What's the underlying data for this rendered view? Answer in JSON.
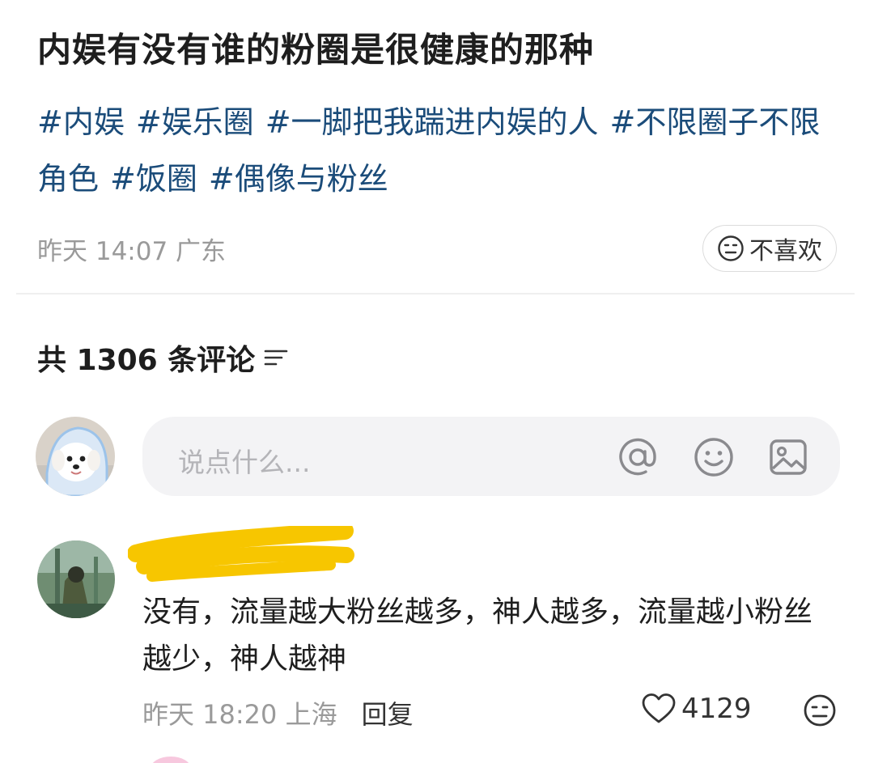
{
  "post": {
    "title": "内娱有没有谁的粉圈是很健康的那种",
    "tags": [
      "#内娱",
      "#娱乐圈",
      "#一脚把我踹进内娱的人",
      "#不限圈子不限角色",
      "#饭圈",
      "#偶像与粉丝"
    ],
    "meta": "昨天 14:07 广东",
    "dislike_label": "不喜欢"
  },
  "comments_header": {
    "label": "共 1306 条评论",
    "sort_icon": "sort-icon"
  },
  "composer": {
    "placeholder": "说点什么...",
    "icons": [
      "at-icon",
      "emoji-icon",
      "image-icon"
    ]
  },
  "comment": {
    "text": "没有，流量越大粉丝越多，神人越多，流量越小粉丝越少，神人越神",
    "time": "昨天 18:20 上海",
    "reply_label": "回复",
    "likes": "4129"
  },
  "colors": {
    "tag": "#1b4c7a",
    "redaction": "#f7c600"
  }
}
